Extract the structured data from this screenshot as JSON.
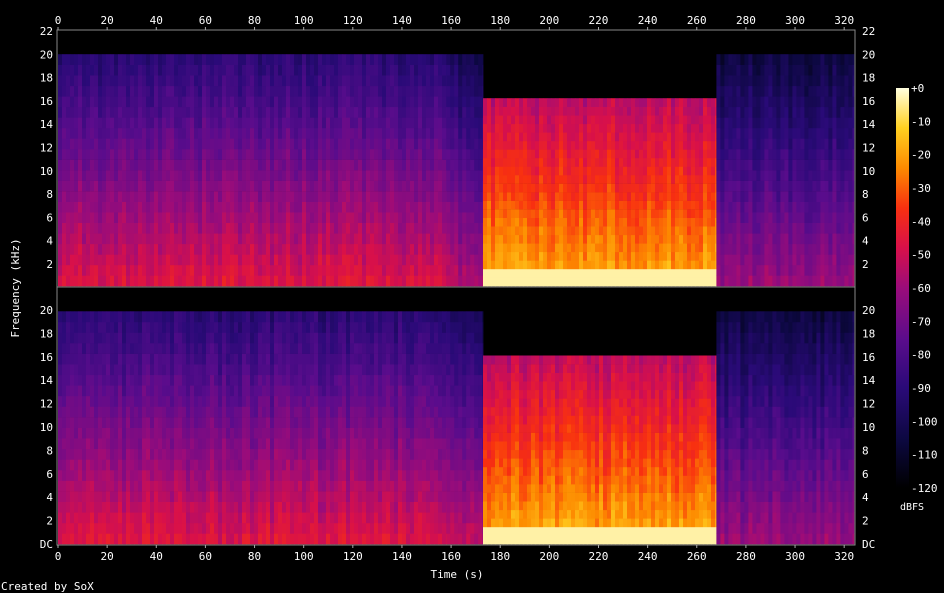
{
  "chart_data": {
    "type": "heatmap",
    "xlabel": "Time (s)",
    "ylabel": "Frequency (kHz)",
    "xlim": [
      0,
      324
    ],
    "ylim_khz": [
      0,
      22
    ],
    "x_ticks": [
      0,
      20,
      40,
      60,
      80,
      100,
      120,
      140,
      160,
      180,
      200,
      220,
      240,
      260,
      280,
      300,
      320
    ],
    "y_ticks_top": [
      "22",
      "20",
      "18",
      "16",
      "14",
      "12",
      "10",
      "8",
      "6",
      "4",
      "2"
    ],
    "y_ticks_bottom": [
      "20",
      "18",
      "16",
      "14",
      "12",
      "10",
      "8",
      "6",
      "4",
      "2",
      "DC"
    ],
    "colorbar": {
      "label": "dBFS",
      "ticks": [
        "+0",
        "-10",
        "-20",
        "-30",
        "-40",
        "-50",
        "-60",
        "-70",
        "-80",
        "-90",
        "-100",
        "-110",
        "-120"
      ],
      "range": [
        -120,
        0
      ]
    },
    "channels": 2,
    "segments": [
      {
        "t_start": 0,
        "t_end": 158,
        "cutoff_khz": 20,
        "intensity": "medium"
      },
      {
        "t_start": 158,
        "t_end": 173,
        "cutoff_khz": 20,
        "intensity": "medium-low"
      },
      {
        "t_start": 173,
        "t_end": 268,
        "cutoff_khz": 16.2,
        "intensity": "high"
      },
      {
        "t_start": 268,
        "t_end": 324,
        "cutoff_khz": 20,
        "intensity": "low"
      }
    ],
    "grid": false
  },
  "footer": {
    "credit": "Created by SoX"
  }
}
